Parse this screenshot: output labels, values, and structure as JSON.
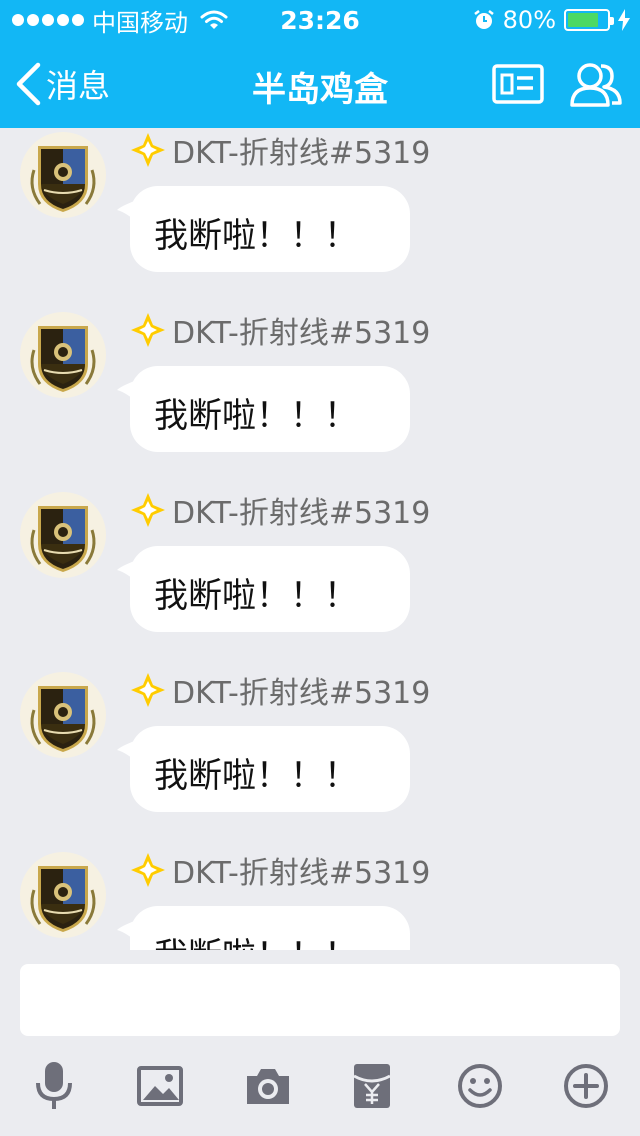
{
  "status_bar": {
    "carrier": "中国移动",
    "time": "23:26",
    "battery": "80%",
    "battery_level": 0.8
  },
  "nav": {
    "back_label": "消息",
    "title": "半岛鸡盒"
  },
  "messages": [
    {
      "sender": "DKT-折射线#5319",
      "text": "我断啦！！！"
    },
    {
      "sender": "DKT-折射线#5319",
      "text": "我断啦！！！"
    },
    {
      "sender": "DKT-折射线#5319",
      "text": "我断啦！！！"
    },
    {
      "sender": "DKT-折射线#5319",
      "text": "我断啦！！！"
    },
    {
      "sender": "DKT-折射线#5319",
      "text": "我断啦！！！"
    }
  ],
  "input": {
    "value": "",
    "placeholder": ""
  },
  "toolbar": [
    "mic-icon",
    "image-icon",
    "camera-icon",
    "red-packet-icon",
    "emoji-icon",
    "plus-icon"
  ],
  "colors": {
    "header": "#12b7f5",
    "background": "#ebecf0",
    "bubble": "#ffffff",
    "badge": "#ffcc00",
    "toolbar_icon": "#6e6f7a"
  }
}
